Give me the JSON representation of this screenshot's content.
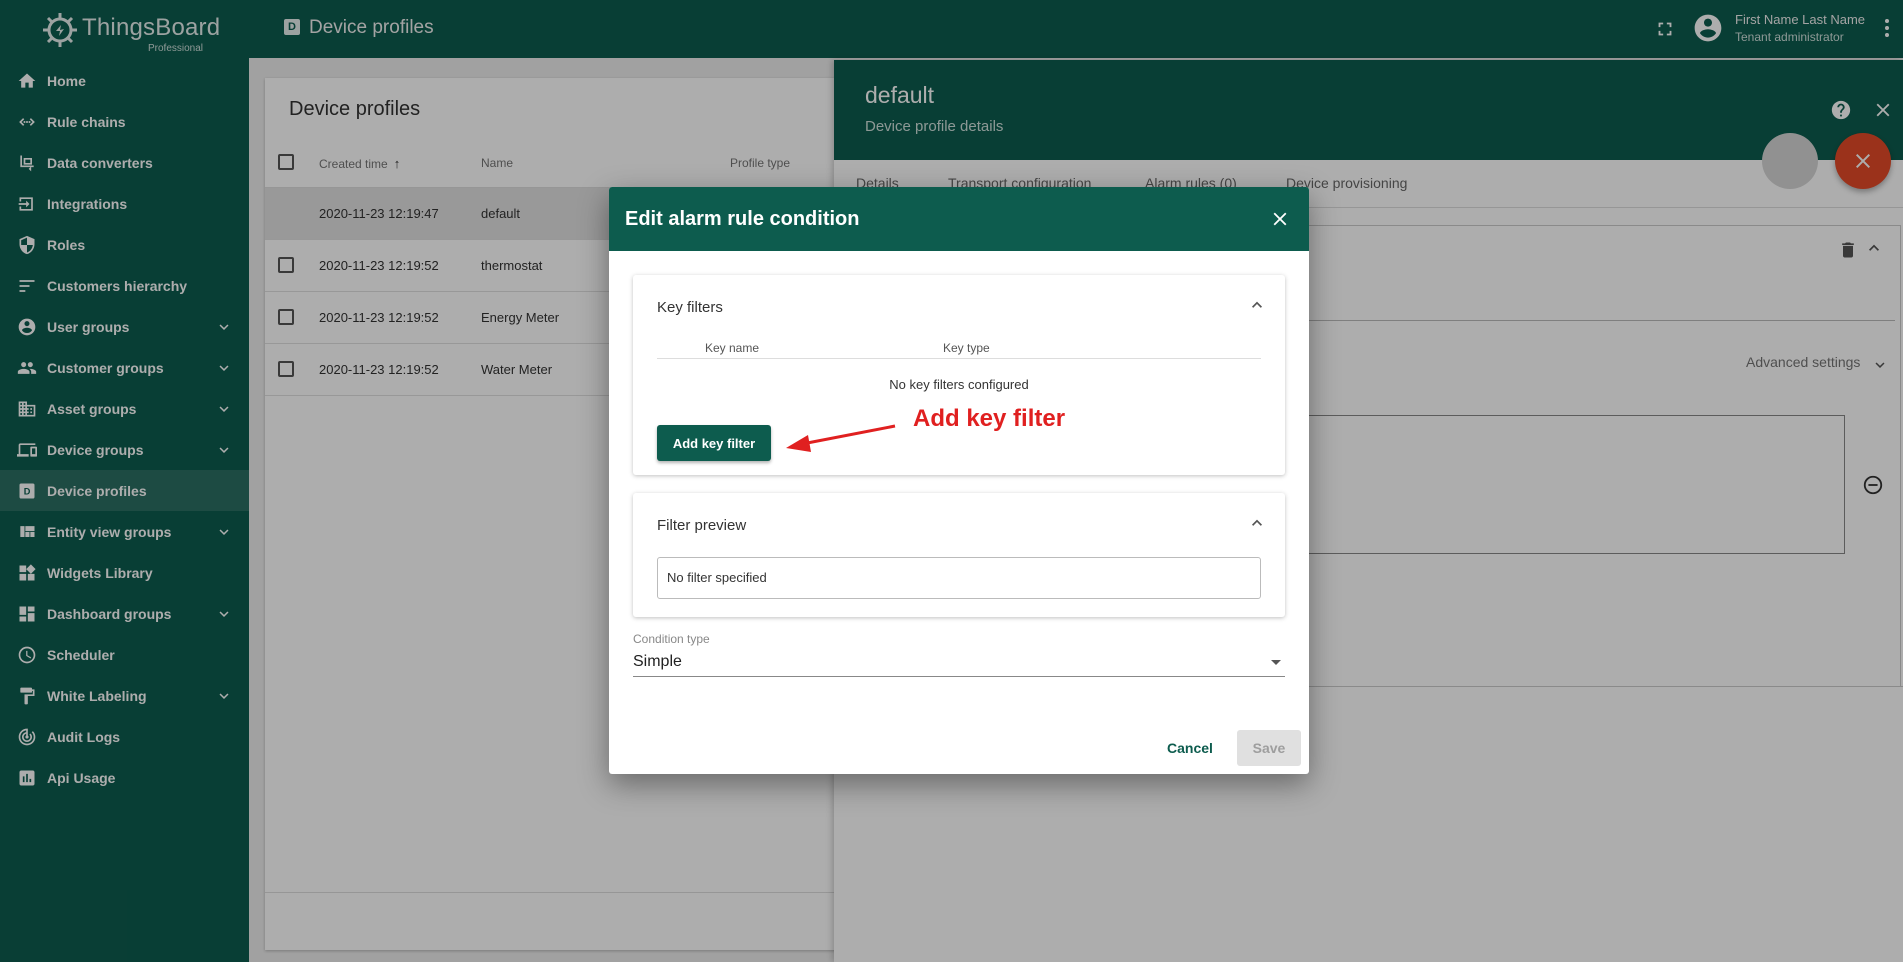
{
  "app": {
    "logo_name": "ThingsBoard",
    "logo_edition": "Professional"
  },
  "sidebar": {
    "items": [
      {
        "label": "Home",
        "icon": "home-icon",
        "expandable": false
      },
      {
        "label": "Rule chains",
        "icon": "rule-chains-icon",
        "expandable": false
      },
      {
        "label": "Data converters",
        "icon": "data-converters-icon",
        "expandable": false
      },
      {
        "label": "Integrations",
        "icon": "integrations-icon",
        "expandable": false
      },
      {
        "label": "Roles",
        "icon": "shield-icon",
        "expandable": false
      },
      {
        "label": "Customers hierarchy",
        "icon": "hierarchy-icon",
        "expandable": false
      },
      {
        "label": "User groups",
        "icon": "account-circle-icon",
        "expandable": true
      },
      {
        "label": "Customer groups",
        "icon": "people-icon",
        "expandable": true
      },
      {
        "label": "Asset groups",
        "icon": "domain-icon",
        "expandable": true
      },
      {
        "label": "Device groups",
        "icon": "devices-icon",
        "expandable": true
      },
      {
        "label": "Device profiles",
        "icon": "device-profile-icon",
        "expandable": false,
        "active": true
      },
      {
        "label": "Entity view groups",
        "icon": "view-quilt-icon",
        "expandable": true
      },
      {
        "label": "Widgets Library",
        "icon": "widgets-icon",
        "expandable": false
      },
      {
        "label": "Dashboard groups",
        "icon": "dashboard-icon",
        "expandable": true
      },
      {
        "label": "Scheduler",
        "icon": "clock-icon",
        "expandable": false
      },
      {
        "label": "White Labeling",
        "icon": "paint-roller-icon",
        "expandable": true
      },
      {
        "label": "Audit Logs",
        "icon": "track-changes-icon",
        "expandable": false
      },
      {
        "label": "Api Usage",
        "icon": "insert-chart-icon",
        "expandable": false
      }
    ]
  },
  "topbar": {
    "page_icon_letter": "D",
    "page_title": "Device profiles",
    "user_name": "First Name Last Name",
    "user_role": "Tenant administrator"
  },
  "list": {
    "title": "Device profiles",
    "columns": {
      "created": "Created time",
      "name": "Name",
      "type": "Profile type"
    },
    "sort_indicator": "↑",
    "rows": [
      {
        "created": "2020-11-23 12:19:47",
        "name": "default",
        "selected": true
      },
      {
        "created": "2020-11-23 12:19:52",
        "name": "thermostat",
        "selected": false
      },
      {
        "created": "2020-11-23 12:19:52",
        "name": "Energy Meter",
        "selected": false
      },
      {
        "created": "2020-11-23 12:19:52",
        "name": "Water Meter",
        "selected": false
      }
    ]
  },
  "drawer": {
    "title": "default",
    "subtitle": "Device profile details",
    "tabs": [
      "Details",
      "Transport configuration",
      "Alarm rules (0)",
      "Device provisioning"
    ],
    "advanced_settings": "Advanced settings"
  },
  "dialog": {
    "title": "Edit alarm rule condition",
    "key_filters": {
      "title": "Key filters",
      "col_key_name": "Key name",
      "col_key_type": "Key type",
      "empty_text": "No key filters configured",
      "add_button": "Add key filter"
    },
    "filter_preview": {
      "title": "Filter preview",
      "value": "No filter specified"
    },
    "condition_type": {
      "label": "Condition type",
      "value": "Simple"
    },
    "cancel_label": "Cancel",
    "save_label": "Save"
  },
  "annotation": {
    "text": "Add key filter",
    "color": "#e02020"
  },
  "colors": {
    "primary": "#0d5c4e",
    "fab_red": "#e54b28"
  }
}
